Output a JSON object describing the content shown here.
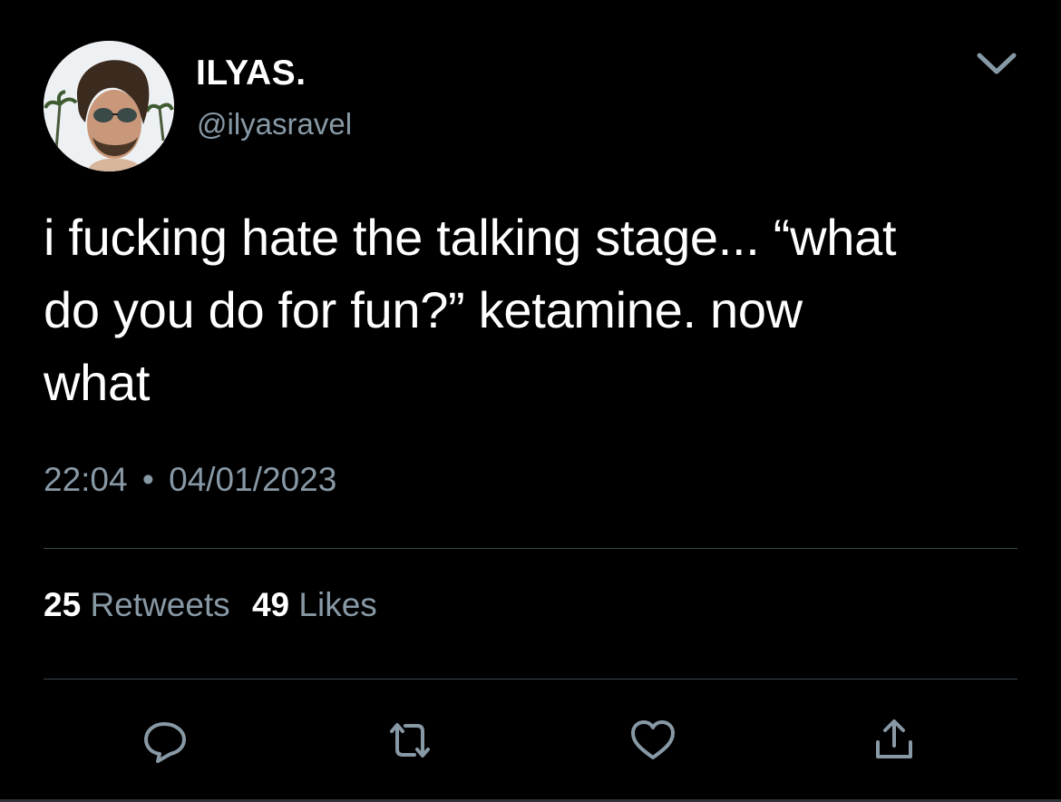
{
  "tweet": {
    "author": {
      "display_name": "ILYAS.",
      "handle": "@ilyasravel"
    },
    "text_lines": [
      "i fucking hate the talking stage... “what",
      "do you do for fun?” ketamine. now",
      "what"
    ],
    "time": "22:04",
    "separator": "•",
    "date": "04/01/2023",
    "stats": {
      "retweets_count": "25",
      "retweets_label": "Retweets",
      "likes_count": "49",
      "likes_label": "Likes"
    },
    "actions": [
      "reply-icon",
      "retweet-icon",
      "like-icon",
      "share-icon"
    ],
    "colors": {
      "background": "#000000",
      "text": "#ffffff",
      "secondary": "#8899a6",
      "divider": "#38444d"
    }
  }
}
